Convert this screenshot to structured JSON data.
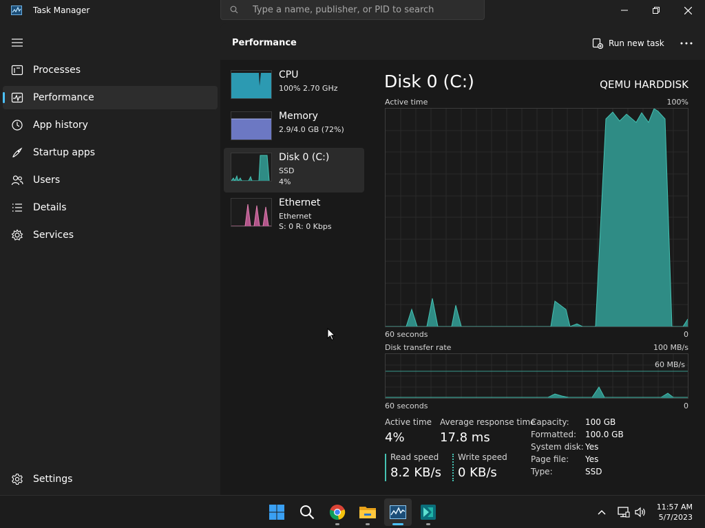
{
  "window": {
    "title": "Task Manager",
    "search_placeholder": "Type a name, publisher, or PID to search"
  },
  "sidebar": {
    "items": [
      {
        "label": "Processes",
        "icon": "processes-icon"
      },
      {
        "label": "Performance",
        "icon": "performance-icon",
        "active": true
      },
      {
        "label": "App history",
        "icon": "app-history-icon"
      },
      {
        "label": "Startup apps",
        "icon": "startup-apps-icon"
      },
      {
        "label": "Users",
        "icon": "users-icon"
      },
      {
        "label": "Details",
        "icon": "details-icon"
      },
      {
        "label": "Services",
        "icon": "services-icon"
      }
    ],
    "settings_label": "Settings"
  },
  "header": {
    "title": "Performance",
    "run_new_task": "Run new task"
  },
  "devices": [
    {
      "name": "CPU",
      "line1": "100%  2.70 GHz",
      "line2": "",
      "color": "#2fa9c3"
    },
    {
      "name": "Memory",
      "line1": "2.9/4.0 GB (72%)",
      "line2": "",
      "color": "#7683d6"
    },
    {
      "name": "Disk 0 (C:)",
      "line1": "SSD",
      "line2": "4%",
      "color": "#3fb8a8",
      "active": true
    },
    {
      "name": "Ethernet",
      "line1": "Ethernet",
      "line2": "S: 0  R: 0 Kbps",
      "color": "#e17fb0"
    }
  ],
  "detail": {
    "title": "Disk 0 (C:)",
    "model": "QEMU HARDDISK",
    "active_time_graph": {
      "label": "Active time",
      "max_label": "100%",
      "time_label": "60 seconds",
      "min_label": "0"
    },
    "transfer_graph": {
      "label": "Disk transfer rate",
      "max_label": "100 MB/s",
      "ref_label": "60 MB/s",
      "time_label": "60 seconds",
      "min_label": "0"
    },
    "stats": {
      "active_time_label": "Active time",
      "active_time_value": "4%",
      "avg_response_label": "Average response time",
      "avg_response_value": "17.8 ms",
      "read_speed_label": "Read speed",
      "read_speed_value": "8.2 KB/s",
      "write_speed_label": "Write speed",
      "write_speed_value": "0 KB/s"
    },
    "properties": [
      {
        "label": "Capacity:",
        "value": "100 GB"
      },
      {
        "label": "Formatted:",
        "value": "100.0 GB"
      },
      {
        "label": "System disk:",
        "value": "Yes"
      },
      {
        "label": "Page file:",
        "value": "Yes"
      },
      {
        "label": "Type:",
        "value": "SSD"
      }
    ]
  },
  "taskbar": {
    "time": "11:57 AM",
    "date": "5/7/2023"
  },
  "colors": {
    "accent": "#4cc2ff",
    "disk_fill": "#2f8c85",
    "disk_line": "#45c2b3"
  }
}
